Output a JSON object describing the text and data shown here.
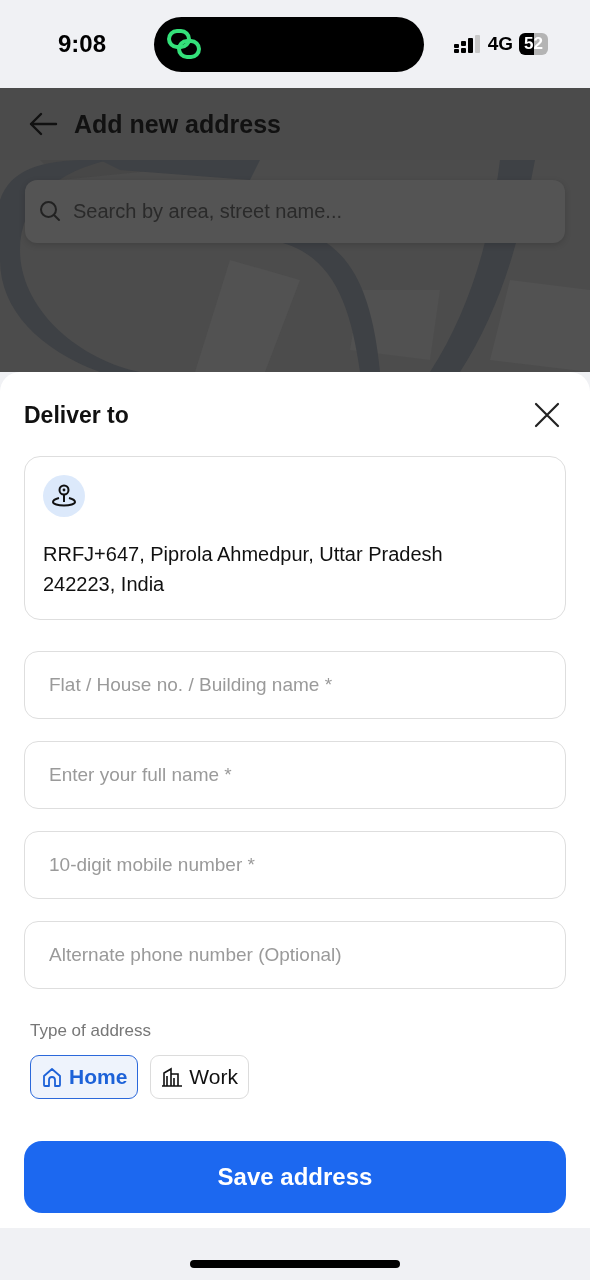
{
  "status_bar": {
    "time": "9:08",
    "network": "4G",
    "battery": "52"
  },
  "header": {
    "title": "Add new address"
  },
  "search": {
    "placeholder": "Search by area, street name..."
  },
  "sheet": {
    "title": "Deliver to",
    "location": {
      "address": "RRFJ+647, Piprola Ahmedpur, Uttar Pradesh 242223, India"
    },
    "fields": [
      {
        "placeholder": "Flat / House no. / Building name *"
      },
      {
        "placeholder": "Enter your full name *"
      },
      {
        "placeholder": "10-digit mobile number *"
      },
      {
        "placeholder": "Alternate phone number (Optional)"
      }
    ],
    "address_type": {
      "label": "Type of address",
      "options": [
        {
          "label": "Home",
          "kind": "home",
          "selected": true
        },
        {
          "label": "Work",
          "kind": "work",
          "selected": false
        }
      ]
    },
    "save_button": "Save address"
  }
}
